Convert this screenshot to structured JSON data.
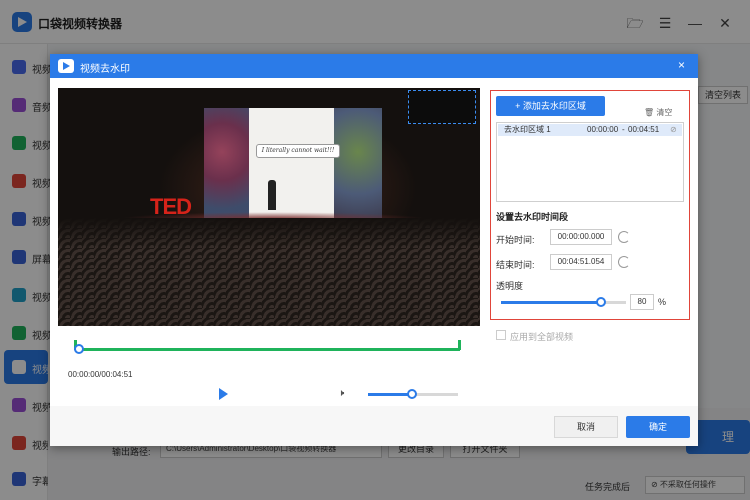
{
  "app": {
    "title": "口袋视频转换器",
    "window_buttons": [
      "folder-icon",
      "menu-icon",
      "minimize-icon",
      "close-icon"
    ]
  },
  "sidebar": {
    "items": [
      {
        "label": "视频",
        "icon_color": "#4a6cf0"
      },
      {
        "label": "音频",
        "icon_color": "#9b4fd8"
      },
      {
        "label": "视频",
        "icon_color": "#1fb35b"
      },
      {
        "label": "视频",
        "icon_color": "#e0453a"
      },
      {
        "label": "视频",
        "icon_color": "#3a63d8"
      },
      {
        "label": "屏幕",
        "icon_color": "#3a63d8"
      },
      {
        "label": "视频",
        "icon_color": "#1fa0c8"
      },
      {
        "label": "视频",
        "icon_color": "#1fb35b"
      },
      {
        "label": "视频",
        "icon_color": "#ffffff",
        "active": true
      },
      {
        "label": "视频",
        "icon_color": "#9b4fd8"
      },
      {
        "label": "视频",
        "icon_color": "#e0453a"
      },
      {
        "label": "字幕/贴图",
        "icon_color": "#3a63d8"
      }
    ]
  },
  "background": {
    "clear_list": "清空列表",
    "output_path_label": "输出路径:",
    "output_path": "C:\\Users\\Administrator\\Desktop\\口袋视频转换器",
    "change_dir": "更改目录",
    "open_folder": "打开文件夹",
    "convert": "理",
    "after_task_label": "任务完成后",
    "after_task_value": "⊘ 不采取任何操作"
  },
  "dialog": {
    "title": "视频去水印",
    "close": "×",
    "video": {
      "slide_text": "I literally cannot wait!!!",
      "stage_logo": "TED",
      "current_time": "00:00:00/00:04:51",
      "volume_fraction": 0.49
    },
    "panel": {
      "add_region": "+ 添加去水印区域",
      "clear": "🗑 清空",
      "regions": [
        {
          "name": "去水印区域 1",
          "start": "00:00:00",
          "end": "00:04:51"
        }
      ],
      "time_section_title": "设置去水印时间段",
      "start_label": "开始时间:",
      "start_value": "00:00:00.000",
      "end_label": "结束时间:",
      "end_value": "00:04:51.054",
      "opacity_label": "透明度",
      "opacity_value": "80",
      "opacity_fraction": 0.8,
      "opacity_unit": "%",
      "apply_all": "应用到全部视频"
    },
    "cancel": "取消",
    "ok": "确定"
  },
  "colors": {
    "accent": "#2b7be8",
    "timeline": "#1fb35b",
    "highlight_border": "#e0453a"
  }
}
